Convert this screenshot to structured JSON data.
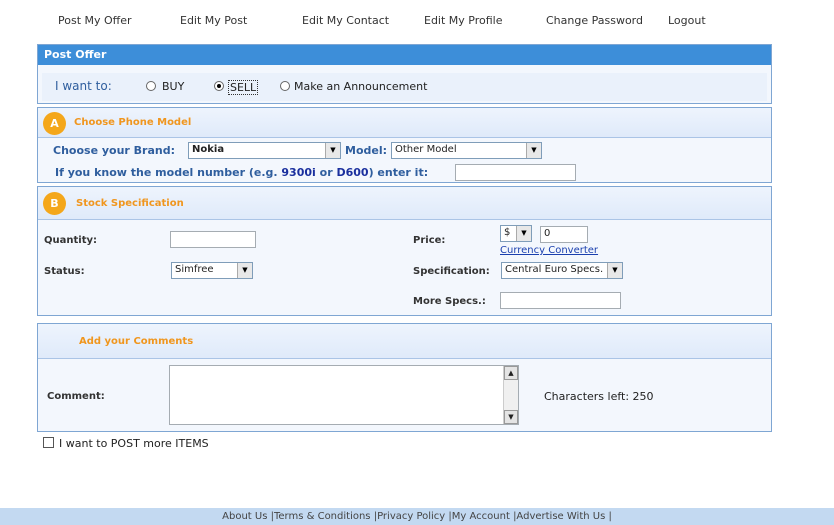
{
  "nav": {
    "post_offer": "Post My Offer",
    "edit_post": "Edit My Post",
    "edit_contact": "Edit My Contact",
    "edit_profile": "Edit My Profile",
    "change_password": "Change Password",
    "logout": "Logout"
  },
  "post_offer": {
    "title": "Post Offer",
    "i_want_to": "I want to:",
    "options": [
      "BUY",
      "SELL",
      "Make an Announcement"
    ],
    "selected": "SELL"
  },
  "section_a": {
    "badge": "A",
    "title": "Choose Phone Model",
    "brand_label": "Choose your Brand:",
    "brand_value": "Nokia",
    "model_label": "Model:",
    "model_value": "Other Model",
    "hint_prefix": "If you know the model number (e.g.",
    "hint_ex1": "9300i",
    "hint_or": "or",
    "hint_ex2": "D600",
    "hint_suffix": ") enter it:",
    "model_number_value": ""
  },
  "section_b": {
    "badge": "B",
    "title": "Stock Specification",
    "quantity_label": "Quantity:",
    "quantity_value": "",
    "status_label": "Status:",
    "status_value": "Simfree",
    "price_label": "Price:",
    "currency_value": "$",
    "price_value": "0",
    "currency_converter": "Currency Converter",
    "specification_label": "Specification:",
    "specification_value": "Central Euro Specs.",
    "more_specs_label": "More Specs.:",
    "more_specs_value": ""
  },
  "comments": {
    "title": "Add your Comments",
    "comment_label": "Comment:",
    "chars_left": "Characters left: 250"
  },
  "post_more": {
    "label": "I want to POST more ITEMS",
    "checked": false
  },
  "footer": {
    "links": [
      "About Us ",
      "|Terms & Conditions ",
      "|Privacy Policy ",
      "|My Account ",
      "|Advertise With Us ",
      "|"
    ]
  }
}
